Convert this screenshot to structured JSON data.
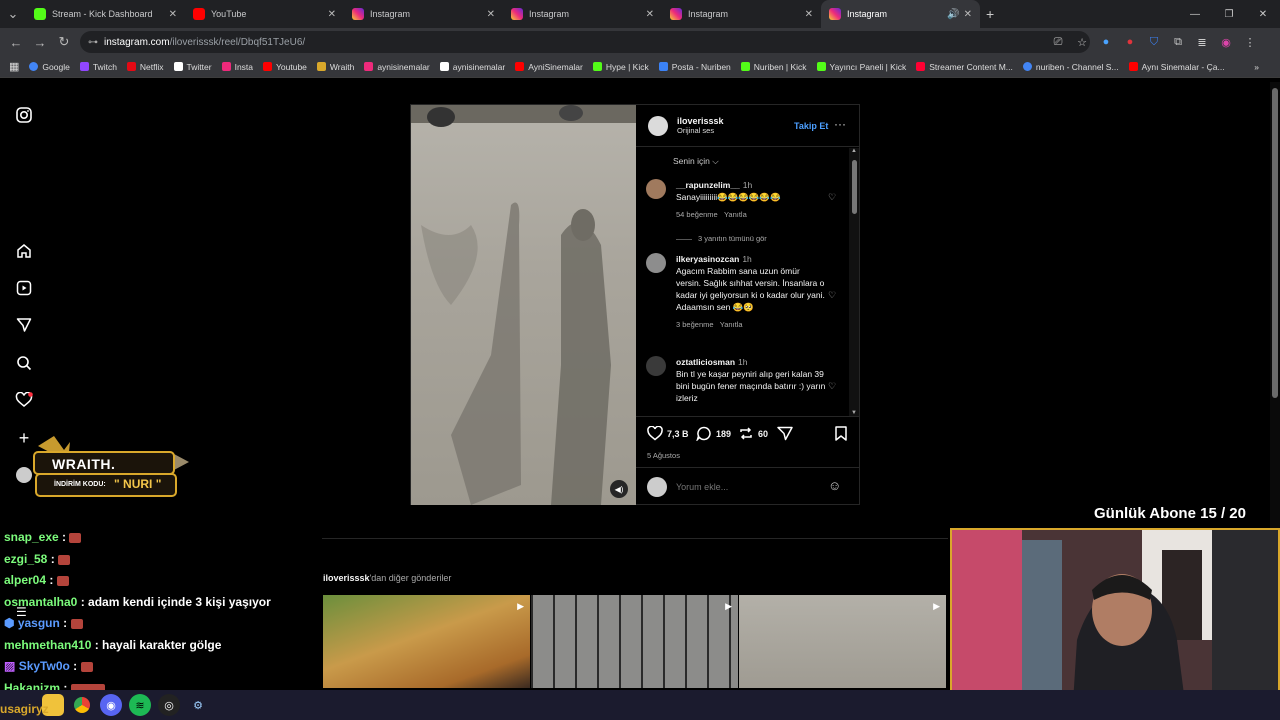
{
  "browser": {
    "tabs": [
      {
        "title": "Stream - Kick Dashboard",
        "icon": "kick-icon"
      },
      {
        "title": "YouTube",
        "icon": "youtube-icon"
      },
      {
        "title": "Instagram",
        "icon": "instagram-icon"
      },
      {
        "title": "Instagram",
        "icon": "instagram-icon"
      },
      {
        "title": "Instagram",
        "icon": "instagram-icon"
      },
      {
        "title": "Instagram",
        "icon": "instagram-icon"
      }
    ],
    "url_host": "instagram.com",
    "url_path": "/iloverisssk/reel/Dbqf51TJeU6/",
    "bookmarks": [
      "Google",
      "Twitch",
      "Netflix",
      "Twitter",
      "Insta",
      "Youtube",
      "Wraith",
      "aynisinemalar",
      "aynisinemalar",
      "AyniSinemalar",
      "Hype | Kick",
      "Posta - Nuriben",
      "Nuriben | Kick",
      "Yayıncı Paneli | Kick",
      "Streamer Content M...",
      "nuriben - Channel S...",
      "Aynı Sinemalar - Ça..."
    ],
    "bookmark_colors": [
      "#4285f4",
      "#9146ff",
      "#e50914",
      "#ffffff",
      "#ee2a7b",
      "#ff0000",
      "#d9a82b",
      "#ee2a7b",
      "#ffffff",
      "#ff0000",
      "#53fc18",
      "#3b82f6",
      "#53fc18",
      "#53fc18",
      "#ff0033",
      "#4285f4",
      "#ff0000"
    ]
  },
  "post": {
    "username": "iloverisssk",
    "audio": "Orijinal ses",
    "follow": "Takip Et",
    "sort": "Senin için",
    "comments": [
      {
        "user": "__rapunzelim__",
        "time": "1h",
        "text": "Sanayiiiiiiiii😂😂😂😂😂😂",
        "likes": "54 beğenme",
        "reply": "Yanıtla",
        "avatar_color": "#a07a5e"
      },
      {
        "user": "ilkeryasinozcan",
        "time": "1h",
        "text": "Agacım Rabbim sana uzun ömür versin. Sağlık sıhhat versin. İnsanlara o kadar iyi geliyorsun ki o kadar olur yani. Adaamsın sen 😂🥺",
        "likes": "3 beğenme",
        "reply": "Yanıtla",
        "avatar_color": "#8d8d8d"
      },
      {
        "user": "oztatliciosman",
        "time": "1h",
        "text": "Bin tl ye kaşar peyniri alıp geri kalan 39 bini bugün fener maçında batırır :) yarın izleriz",
        "likes": "",
        "reply": "",
        "avatar_color": "#3a3a3a"
      }
    ],
    "view_replies": "3 yanıtın tümünü gör",
    "likes": "7,3 B",
    "comment_count": "189",
    "shares": "60",
    "date": "5 Ağustos",
    "add_comment_placeholder": "Yorum ekle..."
  },
  "more_posts": {
    "username": "iloverisssk",
    "suffix": "'dan diğer gönderiler"
  },
  "overlay": {
    "sub_goal": "Günlük Abone 15 / 20",
    "wraith_title": "WRAITH.",
    "wraith_code_label": "İNDİRİM KODU:",
    "wraith_code": "\" NURI \""
  },
  "chat": [
    {
      "user": "snap_exe",
      "msg": "",
      "color": "#7cfc7c"
    },
    {
      "user": "ezgi_58",
      "msg": "",
      "color": "#7cfc7c"
    },
    {
      "user": "alper04",
      "msg": "",
      "color": "#7cfc7c"
    },
    {
      "user": "osmantalha0",
      "msg": "adam kendi içinde 3 kişi yaşıyor",
      "color": "#7cfc7c"
    },
    {
      "user": "yasgun",
      "msg": "",
      "color": "#5b9bff"
    },
    {
      "user": "mehmethan410",
      "msg": "hayali karakter gölge",
      "color": "#7cfc7c"
    },
    {
      "user": "SkyTw0o",
      "msg": "",
      "color": "#5b9bff"
    },
    {
      "user": "Hakanizm",
      "msg": "",
      "color": "#7cfc7c"
    },
    {
      "user": "usagiryz",
      "msg": "",
      "color": "#d9a82b"
    }
  ]
}
